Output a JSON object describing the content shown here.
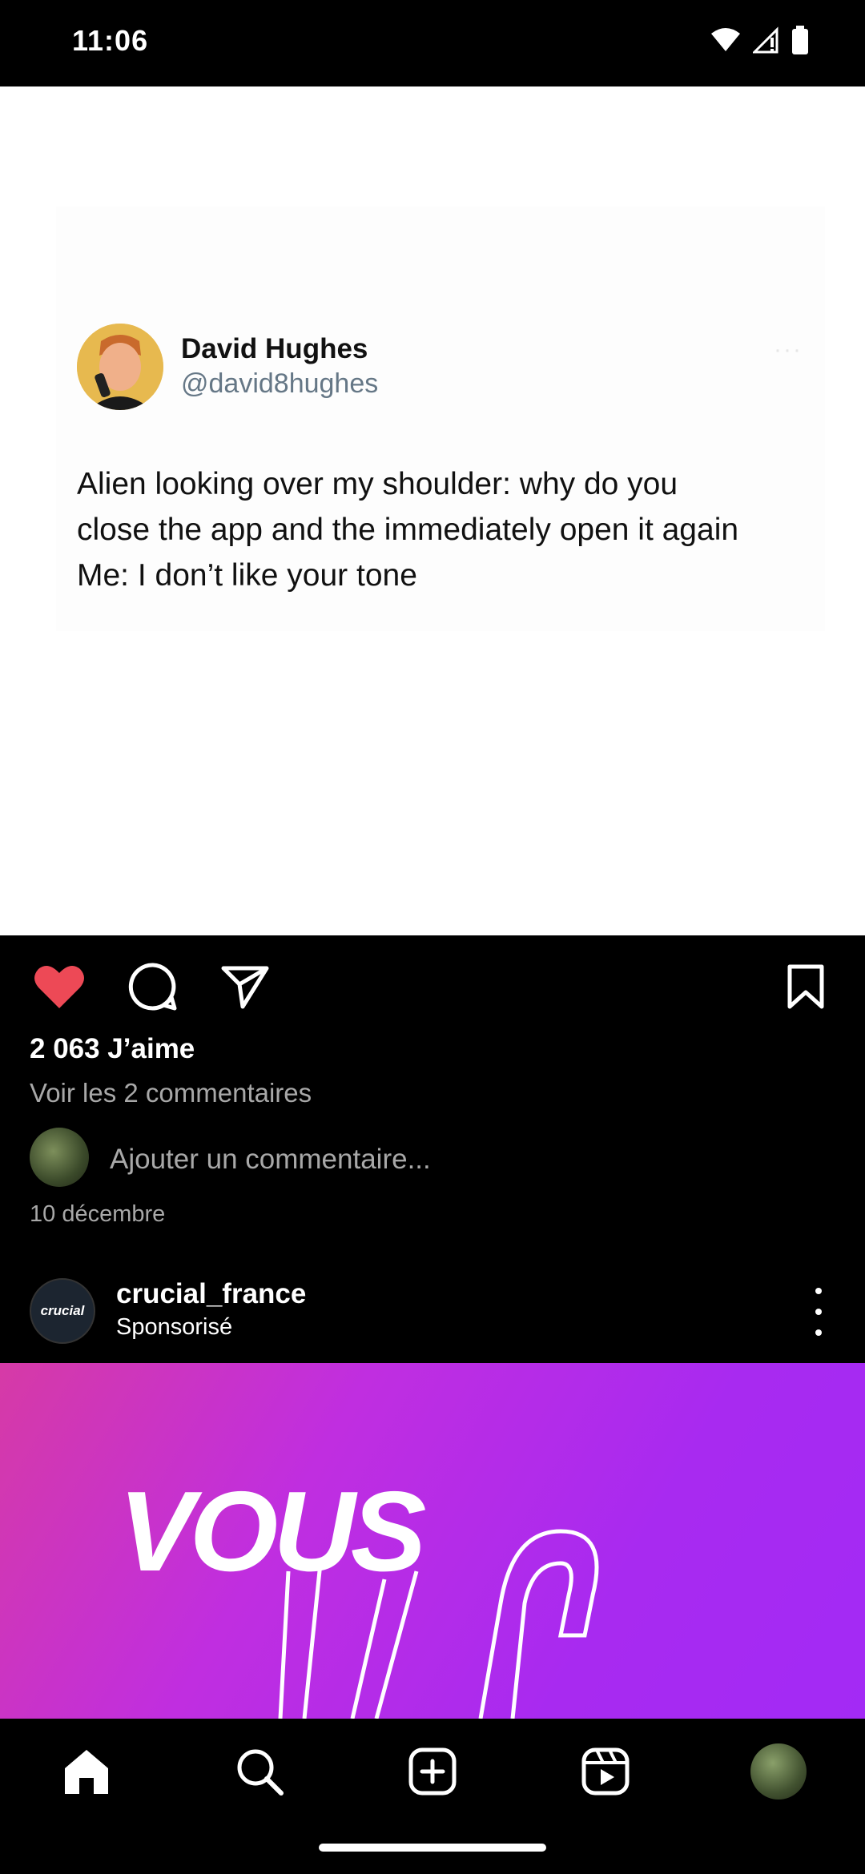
{
  "status_bar": {
    "time": "11:06"
  },
  "tweet": {
    "name": "David Hughes",
    "handle": "@david8hughes",
    "lines": [
      "Alien looking over my shoulder: why do you",
      "close the app and the immediately open it again",
      "Me: I don’t like your tone"
    ]
  },
  "post": {
    "likes": "2 063 J’aime",
    "view_comments": "Voir les 2 commentaires",
    "comment_placeholder": "Ajouter un commentaire...",
    "date": "10 décembre",
    "liked": true
  },
  "sponsored": {
    "avatar_text": "crucial",
    "account": "crucial_france",
    "label": "Sponsorisé",
    "ad_headline": "VOUS"
  },
  "colors": {
    "like_red": "#ed4956",
    "ad_gradient_start": "#d63aa6",
    "ad_gradient_end": "#a32af5"
  },
  "nav": {
    "items": [
      "home-icon",
      "search-icon",
      "create-icon",
      "reels-icon",
      "profile-avatar"
    ]
  }
}
